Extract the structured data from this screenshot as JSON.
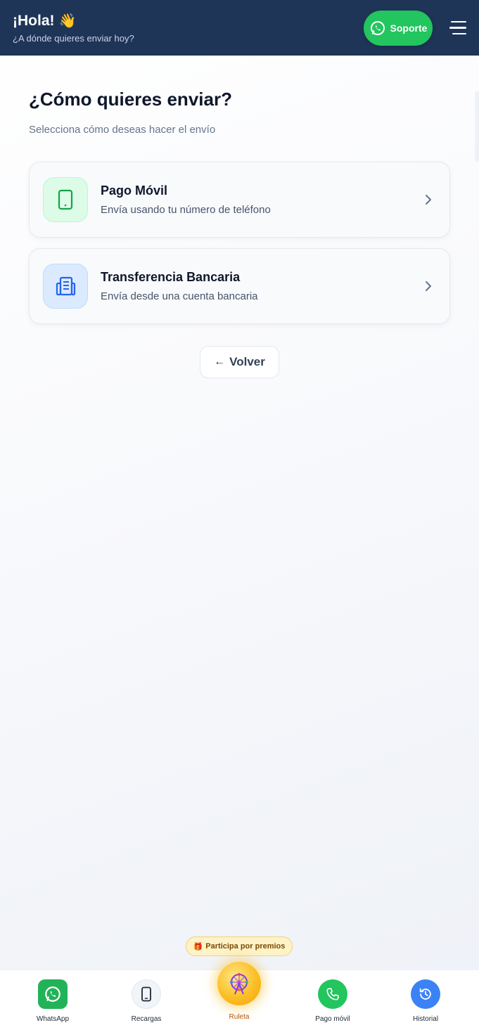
{
  "header": {
    "title": "¡Hola!",
    "wave": "👋",
    "subtitle": "¿A dónde quieres enviar hoy?",
    "support_label": "Soporte"
  },
  "main": {
    "title": "¿Cómo quieres enviar?",
    "subtitle": "Selecciona cómo deseas hacer el envío",
    "options": [
      {
        "title": "Pago Móvil",
        "description": "Envía usando tu número de teléfono",
        "icon": "phone-icon"
      },
      {
        "title": "Transferencia Bancaria",
        "description": "Envía desde una cuenta bancaria",
        "icon": "bank-icon"
      }
    ],
    "back_label": "Volver",
    "back_arrow": "←"
  },
  "promo": {
    "gift": "🎁",
    "label": "Participa por premios"
  },
  "bottom_nav": {
    "items": [
      {
        "label": "WhatsApp",
        "icon": "whatsapp-icon"
      },
      {
        "label": "Recargas",
        "icon": "phone-icon"
      },
      {
        "label": "Ruleta",
        "icon": "ferris-wheel-icon"
      },
      {
        "label": "Pago móvil",
        "icon": "call-icon"
      },
      {
        "label": "Historial",
        "icon": "history-icon"
      }
    ]
  },
  "colors": {
    "header_bg": "#1e3557",
    "accent_green": "#22c55e",
    "accent_blue": "#3b82f6",
    "accent_gold": "#fbbf24"
  }
}
